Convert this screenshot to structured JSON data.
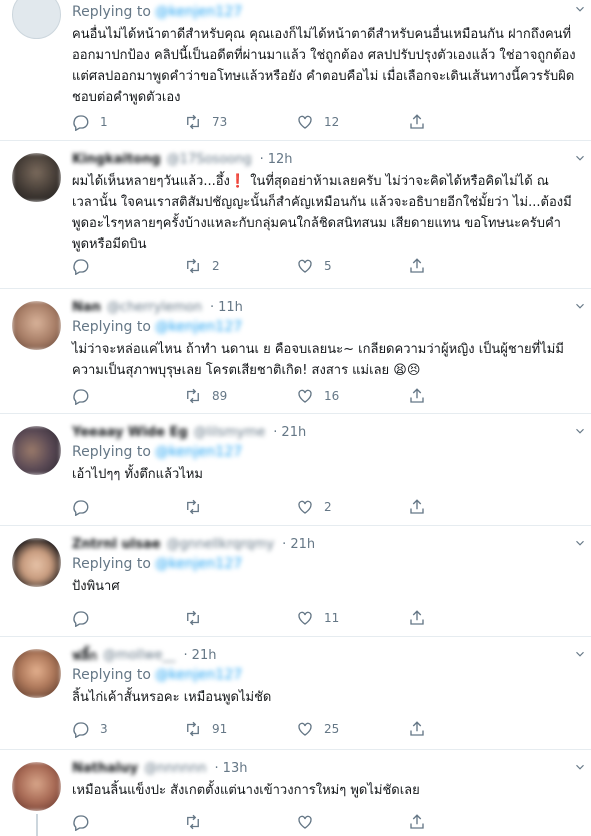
{
  "colors": {
    "accent": "#1da1f2",
    "secondary_text": "#657786",
    "divider": "#e6ecf0"
  },
  "tweets": [
    {
      "name": "",
      "handle": "",
      "time": "",
      "replying_label": "Replying to",
      "mention": "@kenjen127",
      "text": "คนอื่นไม่ได้หน้าตาดีสำหรับคุณ คุณเองก็ไม่ได้หน้าตาดีสำหรับคนอื่นเหมือนกัน ฝากถึงคนที่ออกมาปกป้อง คลิปนี้เป็นอดีตที่ผ่านมาแล้ว ใช่ถูกต้อง ศลปปรับปรุงตัวเองแล้ว ใช่อาจถูกต้อง แต่ศลปออกมาพูดคำว่าขอโทษแล้วหรือยัง คำตอบคือไม่ เมื่อเลือกจะเดินเส้นทางนี้ควรรับผิดชอบต่อคำพูดตัวเอง",
      "replies": "1",
      "retweets": "73",
      "likes": "12"
    },
    {
      "name": "Kingkaitong",
      "handle": "@17Sosoong",
      "time": "12h",
      "replying_label": "",
      "mention": "",
      "text": "ผมได้เห็นหลายๆวันแล้ว...อึ้ง❗️ ในที่สุดอย่าห้ามเลยครับ ไม่ว่าจะคิดได้หรือคิดไม่ได้ ณ เวลานั้น ใจคนเราสติสัมปชัญญะนั้นก็สำคัญเหมือนกัน แล้วจะอธิบายอีกใช่มั้ยว่า ไม่...ต้องมีพูดอะไรๆหลายๆครั้งบ้างแหละกับกลุ่มคนใกล้ชิดสนิทสนม เสียดายแทน ขอโทษนะครับคำพูดหรือมีดบิน",
      "replies": "",
      "retweets": "2",
      "likes": "5"
    },
    {
      "name": "Nan",
      "handle": "@cherrylemon",
      "time": "11h",
      "replying_label": "Replying to",
      "mention": "@kenjen127",
      "text": "ไม่ว่าจะหล่อแค่ไหน ถ้าทำ นดานเ ย คือจบเลยนะ~ เกลียดความว่าผู้หญิง เป็นผู้ชายที่ไม่มีความเป็นสุภาพบุรุษเลย โครตเสียชาติเกิด! สงสาร แม่เลย 😫😣",
      "replies": "",
      "retweets": "89",
      "likes": "16"
    },
    {
      "name": "Yeeaay Wide Eg",
      "handle": "@lilsmyme",
      "time": "21h",
      "replying_label": "Replying to",
      "mention": "@kenjen127",
      "text": "เอ้าไปๆๆ ทั้งตึกแล้วไหม",
      "replies": "",
      "retweets": "",
      "likes": "2"
    },
    {
      "name": "Zntrnl ulsae",
      "handle": "@gnnellkrqrqmy",
      "time": "21h",
      "replying_label": "Replying to",
      "mention": "@kenjen127",
      "text": "ปังพินาศ",
      "replies": "",
      "retweets": "",
      "likes": "11"
    },
    {
      "name": "ฟลิ้ก",
      "handle": "@mollwe__",
      "time": "21h",
      "replying_label": "Replying to",
      "mention": "@kenjen127",
      "text": "ลิ้นไก่เค้าสั้นหรอคะ เหมือนพูดไม่ชัด",
      "replies": "3",
      "retweets": "91",
      "likes": "25"
    },
    {
      "name": "Nathaluy",
      "handle": "@nnnnnn",
      "time": "13h",
      "replying_label": "",
      "mention": "",
      "text": "เหมือนลิ้นแข็งปะ สังเกตตั้งแต่นางเข้าวงการใหม่ๆ พูดไม่ชัดเลย",
      "replies": "",
      "retweets": "",
      "likes": ""
    }
  ],
  "icons": {
    "reply": "reply-icon",
    "retweet": "retweet-icon",
    "like": "heart-icon",
    "share": "share-icon",
    "more": "chevron-down-icon"
  }
}
